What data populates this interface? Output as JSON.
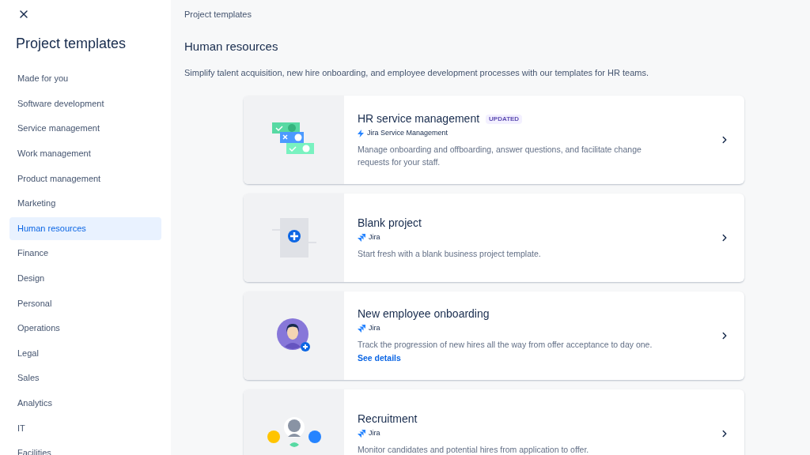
{
  "sidebar": {
    "title": "Project templates",
    "items": [
      {
        "label": "Made for you",
        "selected": false
      },
      {
        "label": "Software development",
        "selected": false
      },
      {
        "label": "Service management",
        "selected": false
      },
      {
        "label": "Work management",
        "selected": false
      },
      {
        "label": "Product management",
        "selected": false
      },
      {
        "label": "Marketing",
        "selected": false
      },
      {
        "label": "Human resources",
        "selected": true
      },
      {
        "label": "Finance",
        "selected": false
      },
      {
        "label": "Design",
        "selected": false
      },
      {
        "label": "Personal",
        "selected": false
      },
      {
        "label": "Operations",
        "selected": false
      },
      {
        "label": "Legal",
        "selected": false
      },
      {
        "label": "Sales",
        "selected": false
      },
      {
        "label": "Analytics",
        "selected": false
      },
      {
        "label": "IT",
        "selected": false
      },
      {
        "label": "Facilities",
        "selected": false
      }
    ]
  },
  "breadcrumb": "Project templates",
  "heading": "Human resources",
  "description": "Simplify talent acquisition, new hire onboarding, and employee development processes with our templates for HR teams.",
  "templates": [
    {
      "kind": "hr",
      "title": "HR service management",
      "badge": "UPDATED",
      "product": {
        "kind": "jsm",
        "name": "Jira Service Management"
      },
      "description": "Manage onboarding and offboarding, answer questions, and facilitate change requests for your staff."
    },
    {
      "kind": "blank",
      "title": "Blank project",
      "product": {
        "kind": "jira",
        "name": "Jira"
      },
      "description": "Start fresh with a blank business project template."
    },
    {
      "kind": "onboarding",
      "title": "New employee onboarding",
      "product": {
        "kind": "jira",
        "name": "Jira"
      },
      "description": "Track the progression of new hires all the way from offer acceptance to day one.",
      "link": "See details"
    },
    {
      "kind": "recruitment",
      "title": "Recruitment",
      "product": {
        "kind": "jira",
        "name": "Jira"
      },
      "description": "Monitor candidates and potential hires from application to offer."
    }
  ]
}
